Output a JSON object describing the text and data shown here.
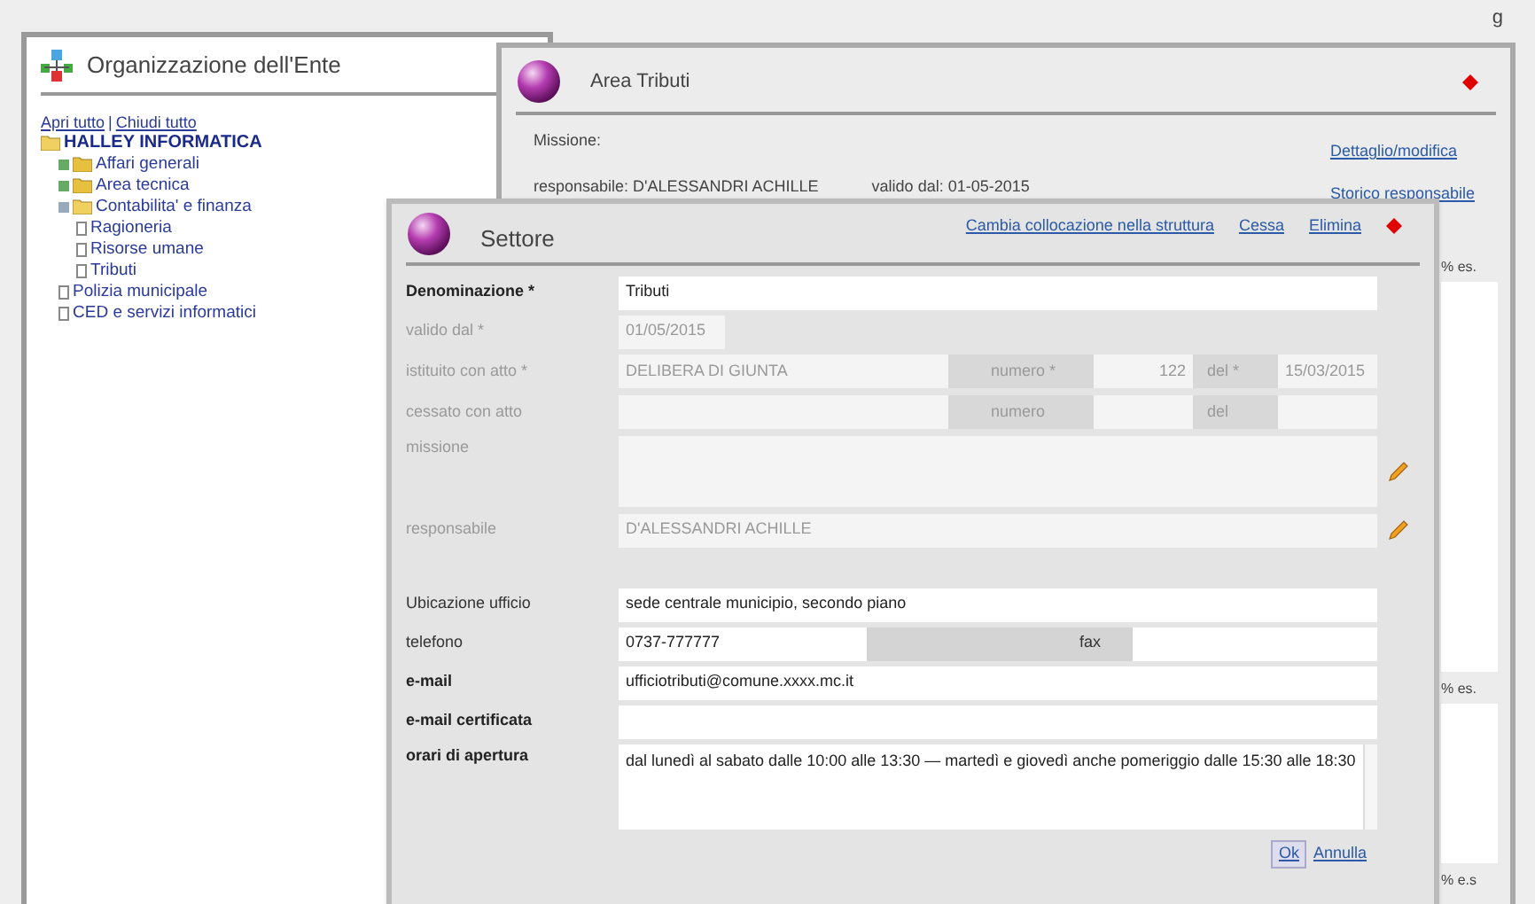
{
  "corner_text": "g",
  "org_window": {
    "title": "Organizzazione dell'Ente",
    "open_all": "Apri tutto",
    "separator": "|",
    "close_all": "Chiudi tutto",
    "tree": [
      {
        "label": "HALLEY INFORMATICA",
        "kind": "root",
        "expanded": true,
        "children": [
          {
            "label": "Affari generali",
            "kind": "folder",
            "expanded": false
          },
          {
            "label": "Area tecnica",
            "kind": "folder",
            "expanded": false
          },
          {
            "label": "Contabilita' e finanza",
            "kind": "folder",
            "expanded": true,
            "children": [
              {
                "label": "Ragioneria",
                "kind": "leaf"
              },
              {
                "label": "Risorse umane",
                "kind": "leaf"
              },
              {
                "label": "Tributi",
                "kind": "leaf"
              }
            ]
          },
          {
            "label": "Polizia municipale",
            "kind": "leaf"
          },
          {
            "label": "CED e servizi informatici",
            "kind": "leaf"
          }
        ]
      }
    ]
  },
  "area_window": {
    "title": "Area Tributi",
    "mission_label": "Missione:",
    "manager": "responsabile: D'ALESSANDRI ACHILLE",
    "valid_from": "valido dal: 01-05-2015",
    "links": [
      "Dettaglio/modifica",
      "Storico responsabile"
    ],
    "column_headers": [
      "% es.",
      "% es.",
      "% e.s"
    ]
  },
  "sector_window": {
    "title": "Settore",
    "links": [
      "Cambia collocazione nella struttura",
      "Cessa",
      "Elimina"
    ],
    "rows": [
      {
        "kind": "single",
        "label": "Denominazione *",
        "value": "Tributi",
        "disabled": false,
        "strong": true
      },
      {
        "kind": "short",
        "label": "valido dal *",
        "value": "01/05/2015",
        "disabled": true
      },
      {
        "kind": "act",
        "label": "istituito con atto *",
        "value": "DELIBERA DI GIUNTA",
        "number_label": "numero *",
        "number": "122",
        "date_label": "del *",
        "date": "15/03/2015",
        "disabled": true
      },
      {
        "kind": "act",
        "label": "cessato con atto",
        "number_label": "numero",
        "date_label": "del",
        "disabled": true
      },
      {
        "kind": "area",
        "label": "missione",
        "disabled": true,
        "pencil": true
      },
      {
        "kind": "single",
        "label": "responsabile",
        "value": "D'ALESSANDRI ACHILLE",
        "disabled": true,
        "pencil": true
      },
      {
        "kind": "gap"
      },
      {
        "kind": "single",
        "label": "Ubicazione ufficio",
        "value": "sede centrale municipio, secondo piano",
        "disabled": false
      },
      {
        "kind": "phone",
        "label": "telefono",
        "value": "0737-777777",
        "fax_label": "fax",
        "disabled": false
      },
      {
        "kind": "single",
        "label": "e-mail",
        "value": "ufficiotributi@comune.xxxx.mc.it",
        "disabled": false,
        "strong": true
      },
      {
        "kind": "single",
        "label": "e-mail certificata",
        "disabled": false,
        "strong": true
      },
      {
        "kind": "area",
        "label": "orari di apertura",
        "value": "dal lunedì al sabato dalle 10:00 alle 13:30 — martedì e giovedì anche pomeriggio dalle 15:30 alle 18:30",
        "disabled": false,
        "strong": true,
        "scrollbar": true
      }
    ],
    "ok": "Ok",
    "cancel": "Annulla"
  }
}
